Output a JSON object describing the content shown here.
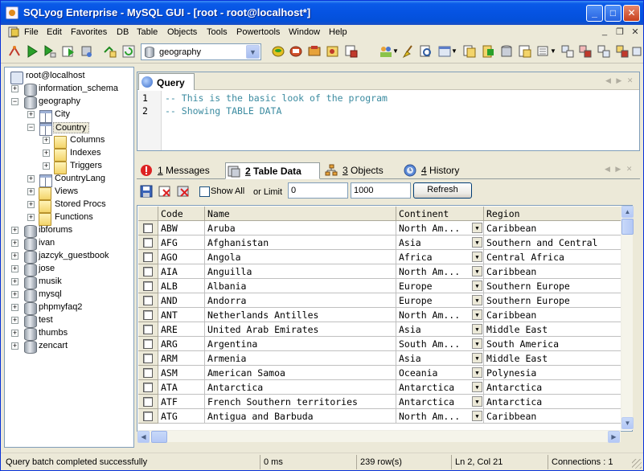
{
  "window": {
    "title": "SQLyog Enterprise - MySQL GUI - [root - root@localhost*]",
    "min_glyph": "_",
    "max_glyph": "□",
    "close_glyph": "✕"
  },
  "menu": {
    "items": [
      "File",
      "Edit",
      "Favorites",
      "DB",
      "Table",
      "Objects",
      "Tools",
      "Powertools",
      "Window",
      "Help"
    ],
    "mdi_min": "_",
    "mdi_restore": "❐",
    "mdi_close": "✕"
  },
  "toolbar": {
    "database_selected": "geography"
  },
  "tree": {
    "root": "root@localhost",
    "items": [
      {
        "label": "information_schema",
        "type": "database",
        "expander": "+"
      },
      {
        "label": "geography",
        "type": "database",
        "expander": "−"
      },
      {
        "label": "City",
        "type": "table",
        "expander": "+"
      },
      {
        "label": "Country",
        "type": "table",
        "expander": "−"
      },
      {
        "label": "Columns",
        "type": "folder",
        "expander": "+"
      },
      {
        "label": "Indexes",
        "type": "folder",
        "expander": "+"
      },
      {
        "label": "Triggers",
        "type": "folder",
        "expander": "+"
      },
      {
        "label": "CountryLang",
        "type": "table",
        "expander": "+"
      },
      {
        "label": "Views",
        "type": "folder",
        "expander": "+"
      },
      {
        "label": "Stored Procs",
        "type": "folder",
        "expander": "+"
      },
      {
        "label": "Functions",
        "type": "folder",
        "expander": "+"
      },
      {
        "label": "ibforums",
        "type": "database",
        "expander": "+"
      },
      {
        "label": "ivan",
        "type": "database",
        "expander": "+"
      },
      {
        "label": "jazcyk_guestbook",
        "type": "database",
        "expander": "+"
      },
      {
        "label": "jose",
        "type": "database",
        "expander": "+"
      },
      {
        "label": "musik",
        "type": "database",
        "expander": "+"
      },
      {
        "label": "mysql",
        "type": "database",
        "expander": "+"
      },
      {
        "label": "phpmyfaq2",
        "type": "database",
        "expander": "+"
      },
      {
        "label": "test",
        "type": "database",
        "expander": "+"
      },
      {
        "label": "thumbs",
        "type": "database",
        "expander": "+"
      },
      {
        "label": "zencart",
        "type": "database",
        "expander": "+"
      }
    ]
  },
  "query": {
    "tab_label": "Query",
    "lines": [
      {
        "num": "1",
        "text": "-- This is the basic look of the program"
      },
      {
        "num": "2",
        "text": "-- Showing TABLE DATA"
      }
    ]
  },
  "result_tabs": [
    {
      "num": "1",
      "label": "Messages"
    },
    {
      "num": "2",
      "label": "Table Data"
    },
    {
      "num": "3",
      "label": "Objects"
    },
    {
      "num": "4",
      "label": "History"
    }
  ],
  "data_toolbar": {
    "show_all": "Show All",
    "or_limit": "or Limit",
    "limit_start": "0",
    "limit_count": "1000",
    "refresh": "Refresh"
  },
  "grid": {
    "columns": [
      "Code",
      "Name",
      "Continent",
      "Region"
    ],
    "dropdown_glyph": "▼",
    "rows": [
      [
        "ABW",
        "Aruba",
        "North Am...",
        "Caribbean"
      ],
      [
        "AFG",
        "Afghanistan",
        "Asia",
        "Southern and Central"
      ],
      [
        "AGO",
        "Angola",
        "Africa",
        "Central Africa"
      ],
      [
        "AIA",
        "Anguilla",
        "North Am...",
        "Caribbean"
      ],
      [
        "ALB",
        "Albania",
        "Europe",
        "Southern Europe"
      ],
      [
        "AND",
        "Andorra",
        "Europe",
        "Southern Europe"
      ],
      [
        "ANT",
        "Netherlands Antilles",
        "North Am...",
        "Caribbean"
      ],
      [
        "ARE",
        "United Arab Emirates",
        "Asia",
        "Middle East"
      ],
      [
        "ARG",
        "Argentina",
        "South Am...",
        "South America"
      ],
      [
        "ARM",
        "Armenia",
        "Asia",
        "Middle East"
      ],
      [
        "ASM",
        "American Samoa",
        "Oceania",
        "Polynesia"
      ],
      [
        "ATA",
        "Antarctica",
        "Antarctica",
        "Antarctica"
      ],
      [
        "ATF",
        "French Southern territories",
        "Antarctica",
        "Antarctica"
      ],
      [
        "ATG",
        "Antigua and Barbuda",
        "North Am...",
        "Caribbean"
      ]
    ]
  },
  "status": {
    "message": "Query batch completed successfully",
    "time": "0 ms",
    "rows": "239 row(s)",
    "position": "Ln 2, Col 21",
    "connections": "Connections : 1"
  },
  "colors": {
    "titlebar": "#0553e2",
    "comment": "#3b8ba0",
    "panel": "#ece9d8"
  }
}
